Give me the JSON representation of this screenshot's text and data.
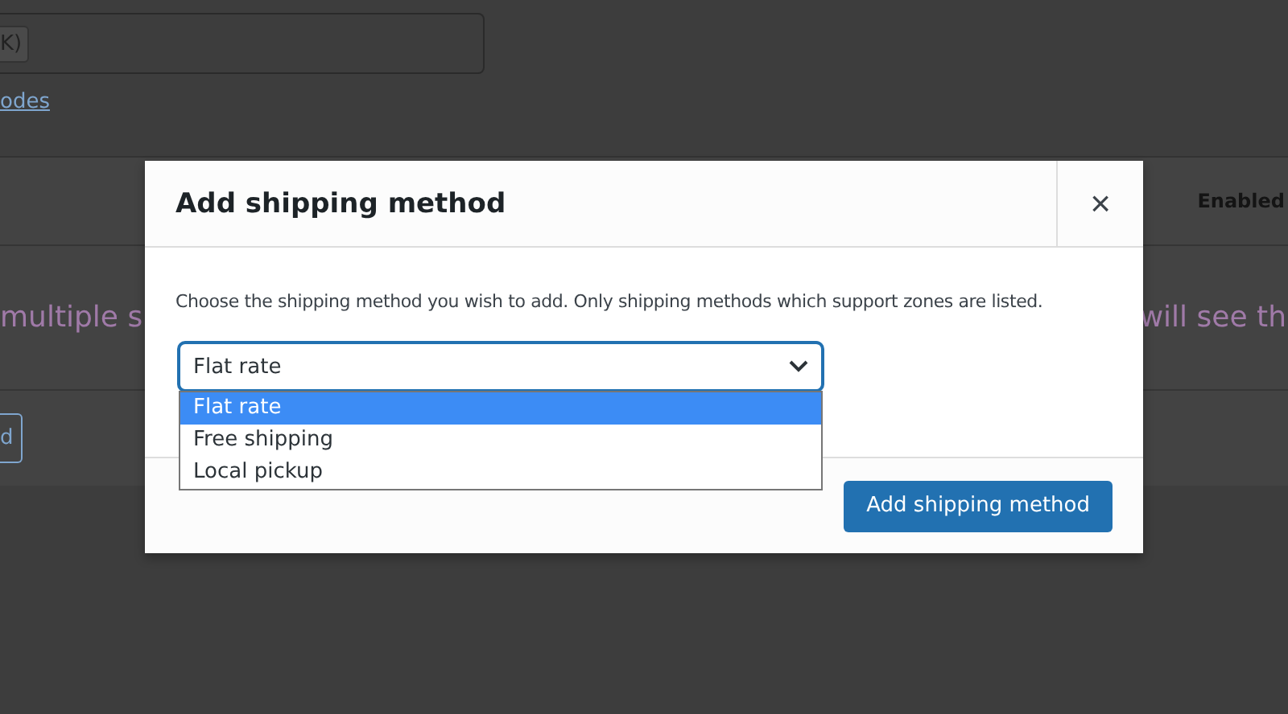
{
  "background_page": {
    "field_chip": "K)",
    "link": "odes",
    "table_header": "Enabled",
    "row_text_left": "multiple s",
    "row_text_right": "will see th",
    "button": "d"
  },
  "modal": {
    "title": "Add shipping method",
    "close": "×",
    "description": "Choose the shipping method you wish to add. Only shipping methods which support zones are listed.",
    "select": {
      "value": "Flat rate",
      "expanded": true,
      "options": [
        {
          "label": "Flat rate",
          "selected": true
        },
        {
          "label": "Free shipping",
          "selected": false
        },
        {
          "label": "Local pickup",
          "selected": false
        }
      ]
    },
    "submit": "Add shipping method"
  }
}
